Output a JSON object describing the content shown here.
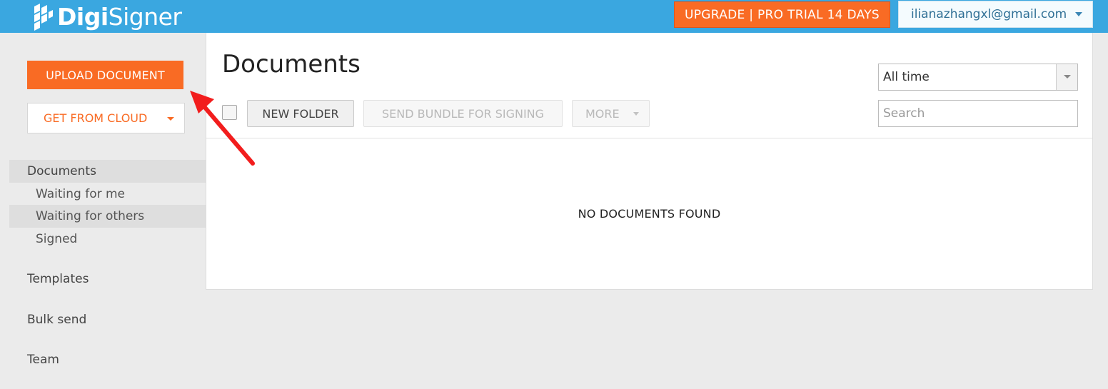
{
  "header": {
    "logo_bold": "Digi",
    "logo_light": "Signer",
    "upgrade_label": "UPGRADE | PRO TRIAL 14 DAYS",
    "account_email": "ilianazhangxl@gmail.com",
    "brand_color": "#3aa7e0",
    "accent_color": "#f96b24"
  },
  "sidebar": {
    "upload_label": "UPLOAD DOCUMENT",
    "cloud_label": "GET FROM CLOUD",
    "items": [
      {
        "label": "Documents"
      },
      {
        "label": "Waiting for me"
      },
      {
        "label": "Waiting for others"
      },
      {
        "label": "Signed"
      },
      {
        "label": "Templates"
      },
      {
        "label": "Bulk send"
      },
      {
        "label": "Team"
      }
    ]
  },
  "main": {
    "title": "Documents",
    "new_folder_label": "NEW FOLDER",
    "send_bundle_label": "SEND BUNDLE FOR SIGNING",
    "more_label": "MORE",
    "time_filter": "All time",
    "search_placeholder": "Search",
    "empty_message": "NO DOCUMENTS FOUND"
  },
  "icons": {
    "logo": "digisigner-logo-icon",
    "annotation": "red-arrow-icon"
  }
}
